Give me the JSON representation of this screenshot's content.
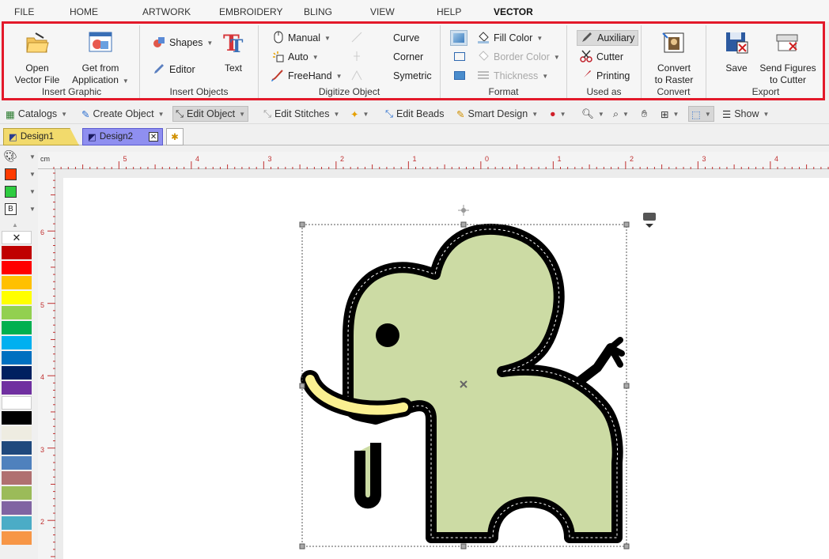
{
  "menubar": {
    "items": [
      {
        "label": "FILE"
      },
      {
        "label": "HOME"
      },
      {
        "label": "ARTWORK"
      },
      {
        "label": "EMBROIDERY"
      },
      {
        "label": "BLING"
      },
      {
        "label": "VIEW"
      },
      {
        "label": "HELP"
      },
      {
        "label": "VECTOR"
      }
    ],
    "active": "VECTOR"
  },
  "ribbon": {
    "insert_graphic": {
      "label": "Insert Graphic",
      "open_vector_file": {
        "line1": "Open",
        "line2": "Vector File"
      },
      "get_from_application": {
        "line1": "Get from",
        "line2": "Application"
      }
    },
    "insert_objects": {
      "label": "Insert Objects",
      "shapes": "Shapes",
      "editor": "Editor",
      "text": "Text"
    },
    "digitize_object": {
      "label": "Digitize Object",
      "manual": "Manual",
      "auto": "Auto",
      "freehand": "FreeHand",
      "curve": "Curve",
      "corner": "Corner",
      "symetric": "Symetric"
    },
    "format": {
      "label": "Format",
      "fill_color": "Fill Color",
      "border_color": "Border Color",
      "thickness": "Thickness"
    },
    "used_as": {
      "label": "Used as",
      "auxiliary": "Auxiliary",
      "cutter": "Cutter",
      "printing": "Printing"
    },
    "convert": {
      "label": "Convert",
      "convert_to_raster": {
        "line1": "Convert",
        "line2": "to Raster"
      }
    },
    "export": {
      "label": "Export",
      "save": "Save",
      "send_figures": {
        "line1": "Send Figures",
        "line2": "to Cutter"
      }
    }
  },
  "toolbar": {
    "catalogs": "Catalogs",
    "create_object": "Create Object",
    "edit_object": "Edit Object",
    "edit_stitches": "Edit Stitches",
    "edit_beads": "Edit Beads",
    "smart_design": "Smart Design",
    "show": "Show"
  },
  "tabs": [
    {
      "label": "Design1"
    },
    {
      "label": "Design2"
    }
  ],
  "colorbar": {
    "current": {
      "fg": "#ff3b00",
      "bg": "#2ecc40",
      "b_label": "B"
    },
    "palette": [
      "#c00000",
      "#ff0000",
      "#ffc000",
      "#ffff00",
      "#92d050",
      "#00b050",
      "#00b0f0",
      "#0070c0",
      "#002060",
      "#7030a0",
      "#ffffff",
      "#000000",
      "#eeece1",
      "#1f497d",
      "#4f81bd",
      "#b07070",
      "#9bbb59",
      "#8064a2",
      "#4bacc6",
      "#f79646"
    ]
  },
  "ruler": {
    "unit": "cm",
    "top_labels": [
      "5",
      "4",
      "3",
      "2",
      "1",
      "0",
      "1",
      "2",
      "3",
      "4"
    ],
    "left_labels": [
      "6",
      "5",
      "4",
      "3",
      "2"
    ]
  },
  "colors": {
    "accent_red": "#e3192a",
    "elephant_fill": "#ccdba4",
    "tusk": "#faf091"
  }
}
